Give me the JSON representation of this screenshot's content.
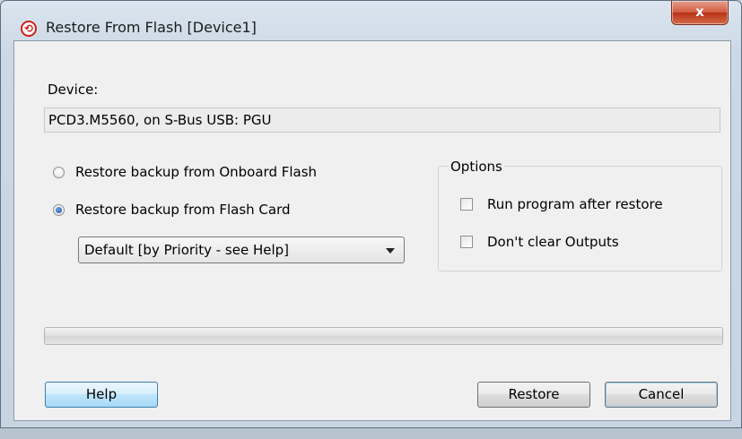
{
  "window": {
    "title": "Restore From Flash [Device1]",
    "close_glyph": "x"
  },
  "device": {
    "label": "Device:",
    "value": "PCD3.M5560, on S-Bus USB: PGU"
  },
  "restore_source": {
    "onboard_label": "Restore backup from Onboard Flash",
    "card_label": "Restore backup from Flash Card",
    "selected": "card",
    "card_dropdown_value": "Default [by Priority - see Help]"
  },
  "options": {
    "title": "Options",
    "run_after_label": "Run program after restore",
    "run_after_checked": false,
    "dont_clear_label": "Don't clear Outputs",
    "dont_clear_checked": false
  },
  "progress": {
    "value": 0
  },
  "buttons": {
    "help": "Help",
    "restore": "Restore",
    "cancel": "Cancel"
  },
  "colors": {
    "accent": "#3c7fb1",
    "close_red": "#c9452a",
    "dialog_bg": "#f0f0f0"
  }
}
